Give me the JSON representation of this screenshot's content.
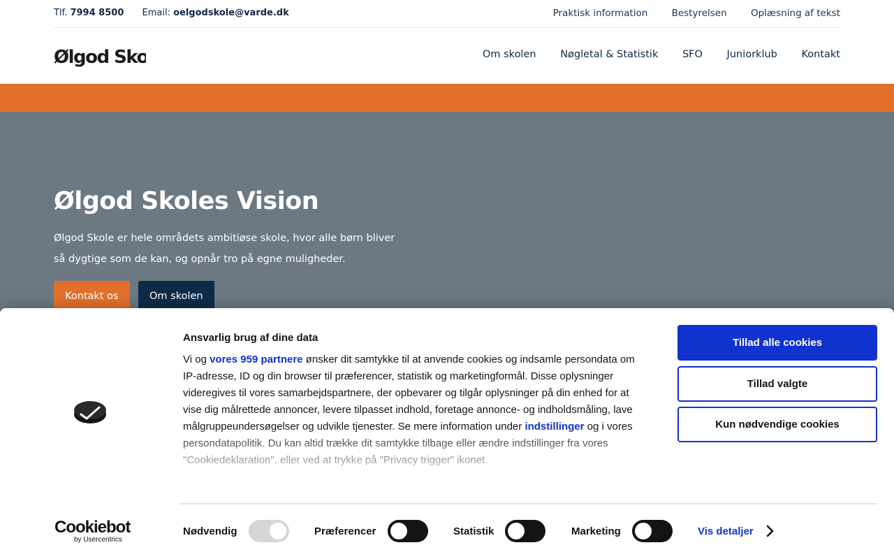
{
  "topbar": {
    "phone_label": "Tlf.",
    "phone": "7994 8500",
    "email_label": "Email:",
    "email": "oelgodskole@varde.dk",
    "links": [
      "Praktisk information",
      "Bestyrelsen",
      "Oplæsning af tekst"
    ]
  },
  "header": {
    "logo_text": "Ølgod Skole",
    "nav": [
      "Om skolen",
      "Nøgletal & Statistik",
      "SFO",
      "Juniorklub",
      "Kontakt"
    ]
  },
  "colors": {
    "orange": "#e2702a",
    "navy": "#0d2b49",
    "hero_bg": "#6c7882",
    "cookie_blue": "#1032cf"
  },
  "hero": {
    "title": "Ølgod Skoles Vision",
    "text": "Ølgod Skole er hele områdets ambitiøse skole, hvor alle børn bliver så dygtige som de kan, og opnår tro på egne muligheder.",
    "btn_contact": "Kontakt os",
    "btn_about": "Om skolen"
  },
  "cookie": {
    "title": "Ansvarlig brug af dine data",
    "body_pre": "Vi og ",
    "partners_link": "vores 959 partnere",
    "body_mid": " ønsker dit samtykke til at anvende cookies og indsamle persondata om IP-adresse, ID og din browser til præferencer, statistik og marketingformål. Disse oplysninger videregives til vores samarbejdspartnere, der opbevarer og tilgår oplysninger på din enhed for at vise dig målrettede annoncer, levere tilpasset indhold, foretage annonce- og indholdsmåling, lave målgruppeundersøgelser og udvikle tjenester. Se mere information under ",
    "settings_link": "indstillinger",
    "body_post": " og i vores persondatapolitik. Du kan altid trække dit samtykke tilbage eller ændre indstillinger fra vores \"Cookiedeklaration\", eller ved at trykke på \"Privacy trigger\" ikonet.",
    "btn_allow_all": "Tillad alle cookies",
    "btn_allow_selected": "Tillad valgte",
    "btn_necessary": "Kun nødvendige cookies",
    "toggles": [
      {
        "label": "Nødvendig",
        "on": true,
        "disabled": true
      },
      {
        "label": "Præferencer",
        "on": false,
        "disabled": false
      },
      {
        "label": "Statistik",
        "on": false,
        "disabled": false
      },
      {
        "label": "Marketing",
        "on": false,
        "disabled": false
      }
    ],
    "details_link": "Vis detaljer",
    "logo_main": "Cookiebot",
    "logo_sub": "by Usercentrics",
    "badge_icon": "cookiebot-badge-icon"
  }
}
